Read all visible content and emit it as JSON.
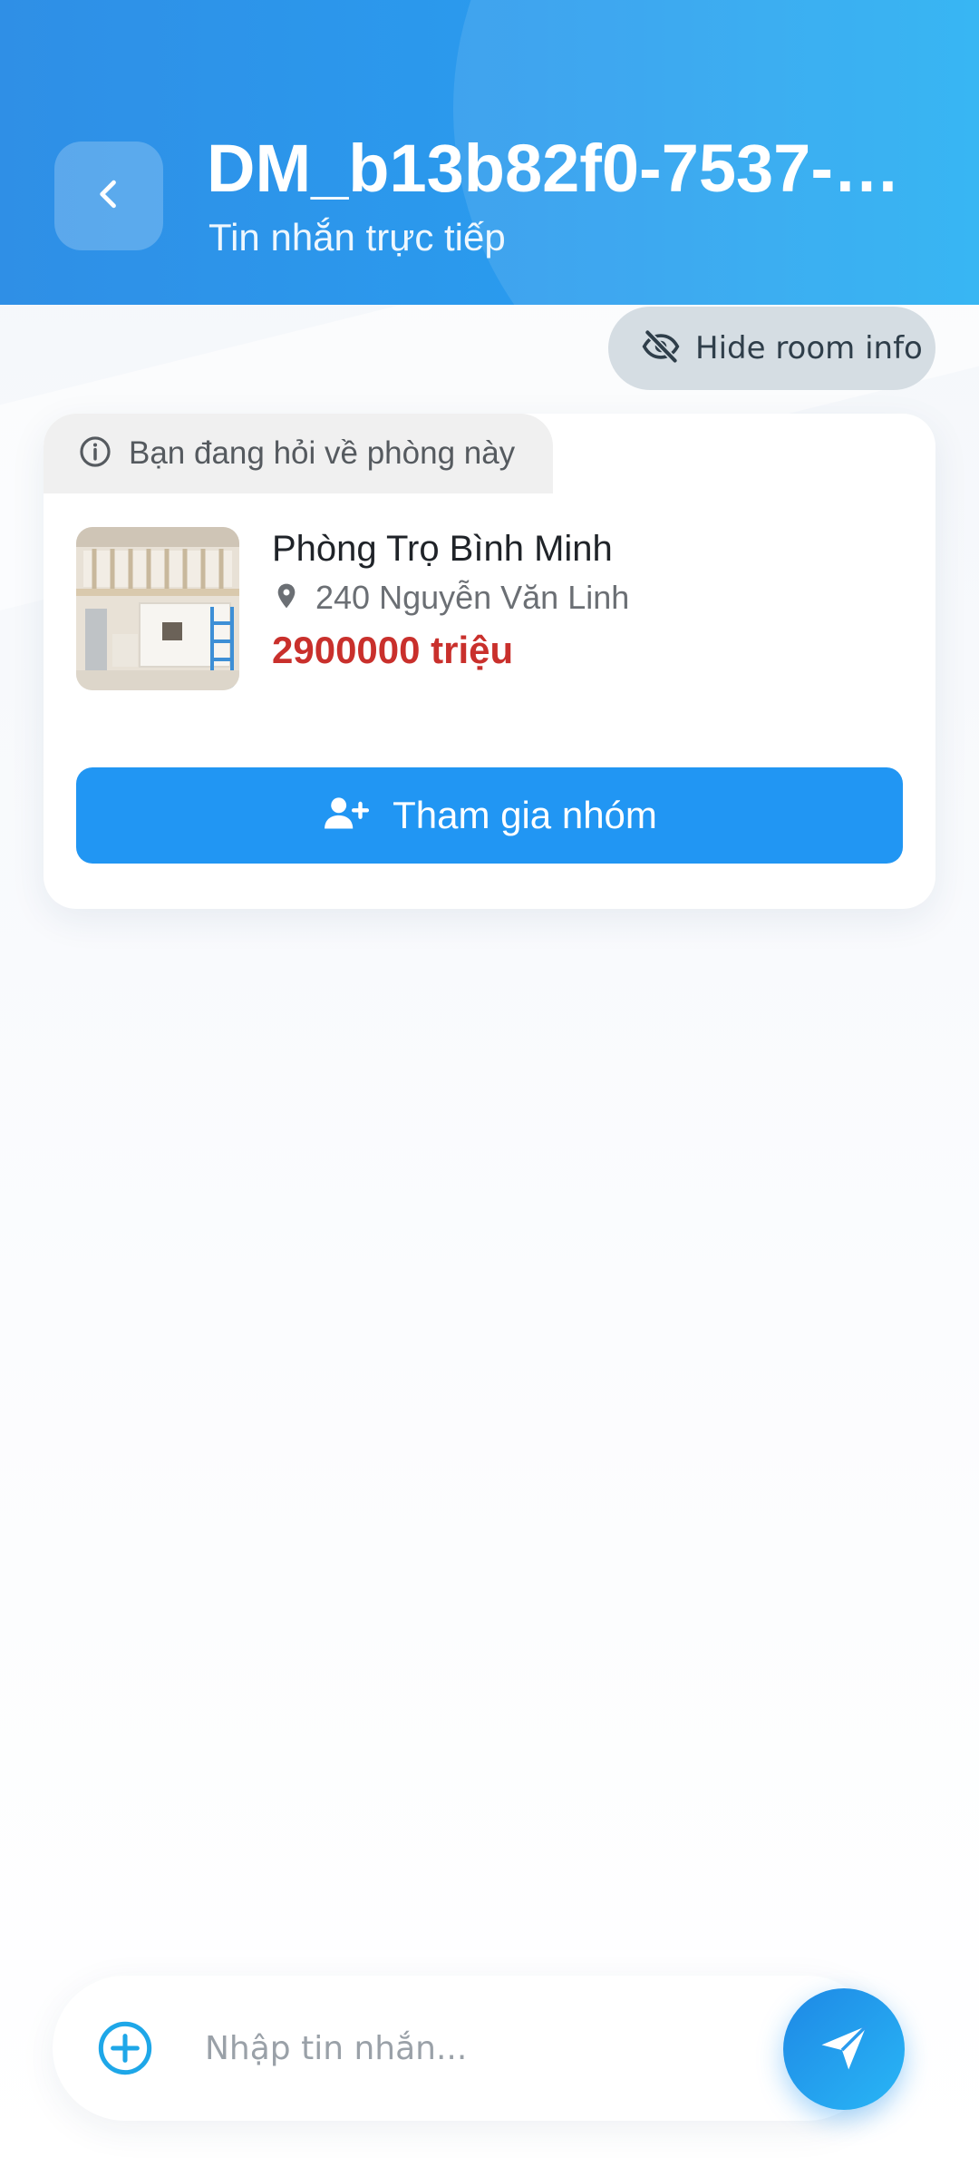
{
  "header": {
    "title": "DM_b13b82f0-7537-4...",
    "subtitle": "Tin nhắn trực tiếp",
    "back_icon": "chevron-left-icon",
    "gradient_start": "#2f8fe6",
    "gradient_end": "#22aef2"
  },
  "room_info_toggle": {
    "label": "Hide room info",
    "icon": "eye-off-icon"
  },
  "room_card": {
    "tab_label": "Bạn đang hỏi về phòng này",
    "tab_icon": "info-icon",
    "room_name": "Phòng Trọ Bình Minh",
    "address": "240 Nguyễn Văn Linh",
    "address_icon": "location-pin-icon",
    "price": "2900000 triệu",
    "price_color": "#c9302c",
    "join_button_label": "Tham gia nhóm",
    "join_button_icon": "user-plus-icon",
    "join_button_color": "#2196f3"
  },
  "composer": {
    "placeholder": "Nhập tin nhắn...",
    "add_icon": "plus-circle-icon",
    "send_icon": "send-icon"
  }
}
